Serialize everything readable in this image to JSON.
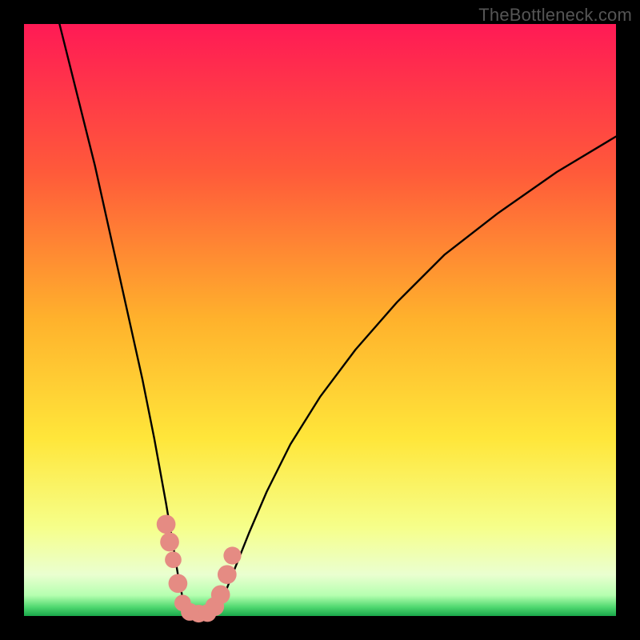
{
  "watermark": "TheBottleneck.com",
  "chart_data": {
    "type": "line",
    "title": "",
    "xlabel": "",
    "ylabel": "",
    "xlim": [
      0,
      100
    ],
    "ylim": [
      0,
      100
    ],
    "background": {
      "kind": "vertical-gradient",
      "stops": [
        {
          "pos": 0.0,
          "color": "#ff1a55"
        },
        {
          "pos": 0.25,
          "color": "#ff5a3a"
        },
        {
          "pos": 0.5,
          "color": "#ffb22c"
        },
        {
          "pos": 0.7,
          "color": "#ffe63a"
        },
        {
          "pos": 0.85,
          "color": "#f6ff8a"
        },
        {
          "pos": 0.93,
          "color": "#eaffd0"
        },
        {
          "pos": 0.965,
          "color": "#b6ffb0"
        },
        {
          "pos": 0.985,
          "color": "#4fd870"
        },
        {
          "pos": 1.0,
          "color": "#1aa84a"
        }
      ]
    },
    "series": [
      {
        "name": "left-curve",
        "x": [
          6,
          8,
          10,
          12,
          14,
          16,
          18,
          20,
          22,
          24,
          25,
          26,
          27,
          28
        ],
        "y": [
          100,
          92,
          84,
          76,
          67,
          58,
          49,
          40,
          30,
          19,
          13,
          7,
          2,
          0
        ]
      },
      {
        "name": "right-curve",
        "x": [
          32,
          34,
          36,
          38,
          41,
          45,
          50,
          56,
          63,
          71,
          80,
          90,
          100
        ],
        "y": [
          0,
          4,
          9,
          14,
          21,
          29,
          37,
          45,
          53,
          61,
          68,
          75,
          81
        ]
      },
      {
        "name": "bottom-join",
        "x": [
          28,
          30,
          32
        ],
        "y": [
          0,
          0,
          0
        ]
      }
    ],
    "markers": [
      {
        "x": 24.0,
        "y": 15.5,
        "r": 1.6,
        "color": "#e58b83"
      },
      {
        "x": 24.6,
        "y": 12.5,
        "r": 1.6,
        "color": "#e58b83"
      },
      {
        "x": 25.2,
        "y": 9.5,
        "r": 1.4,
        "color": "#e58b83"
      },
      {
        "x": 26.0,
        "y": 5.5,
        "r": 1.6,
        "color": "#e58b83"
      },
      {
        "x": 26.8,
        "y": 2.2,
        "r": 1.4,
        "color": "#e58b83"
      },
      {
        "x": 28.0,
        "y": 0.7,
        "r": 1.5,
        "color": "#e58b83"
      },
      {
        "x": 29.5,
        "y": 0.4,
        "r": 1.5,
        "color": "#e58b83"
      },
      {
        "x": 31.0,
        "y": 0.5,
        "r": 1.5,
        "color": "#e58b83"
      },
      {
        "x": 32.2,
        "y": 1.6,
        "r": 1.6,
        "color": "#e58b83"
      },
      {
        "x": 33.2,
        "y": 3.6,
        "r": 1.6,
        "color": "#e58b83"
      },
      {
        "x": 34.3,
        "y": 7.0,
        "r": 1.6,
        "color": "#e58b83"
      },
      {
        "x": 35.2,
        "y": 10.2,
        "r": 1.5,
        "color": "#e58b83"
      }
    ],
    "frame": {
      "outer_border_width_px": 30,
      "color": "#000000"
    }
  }
}
